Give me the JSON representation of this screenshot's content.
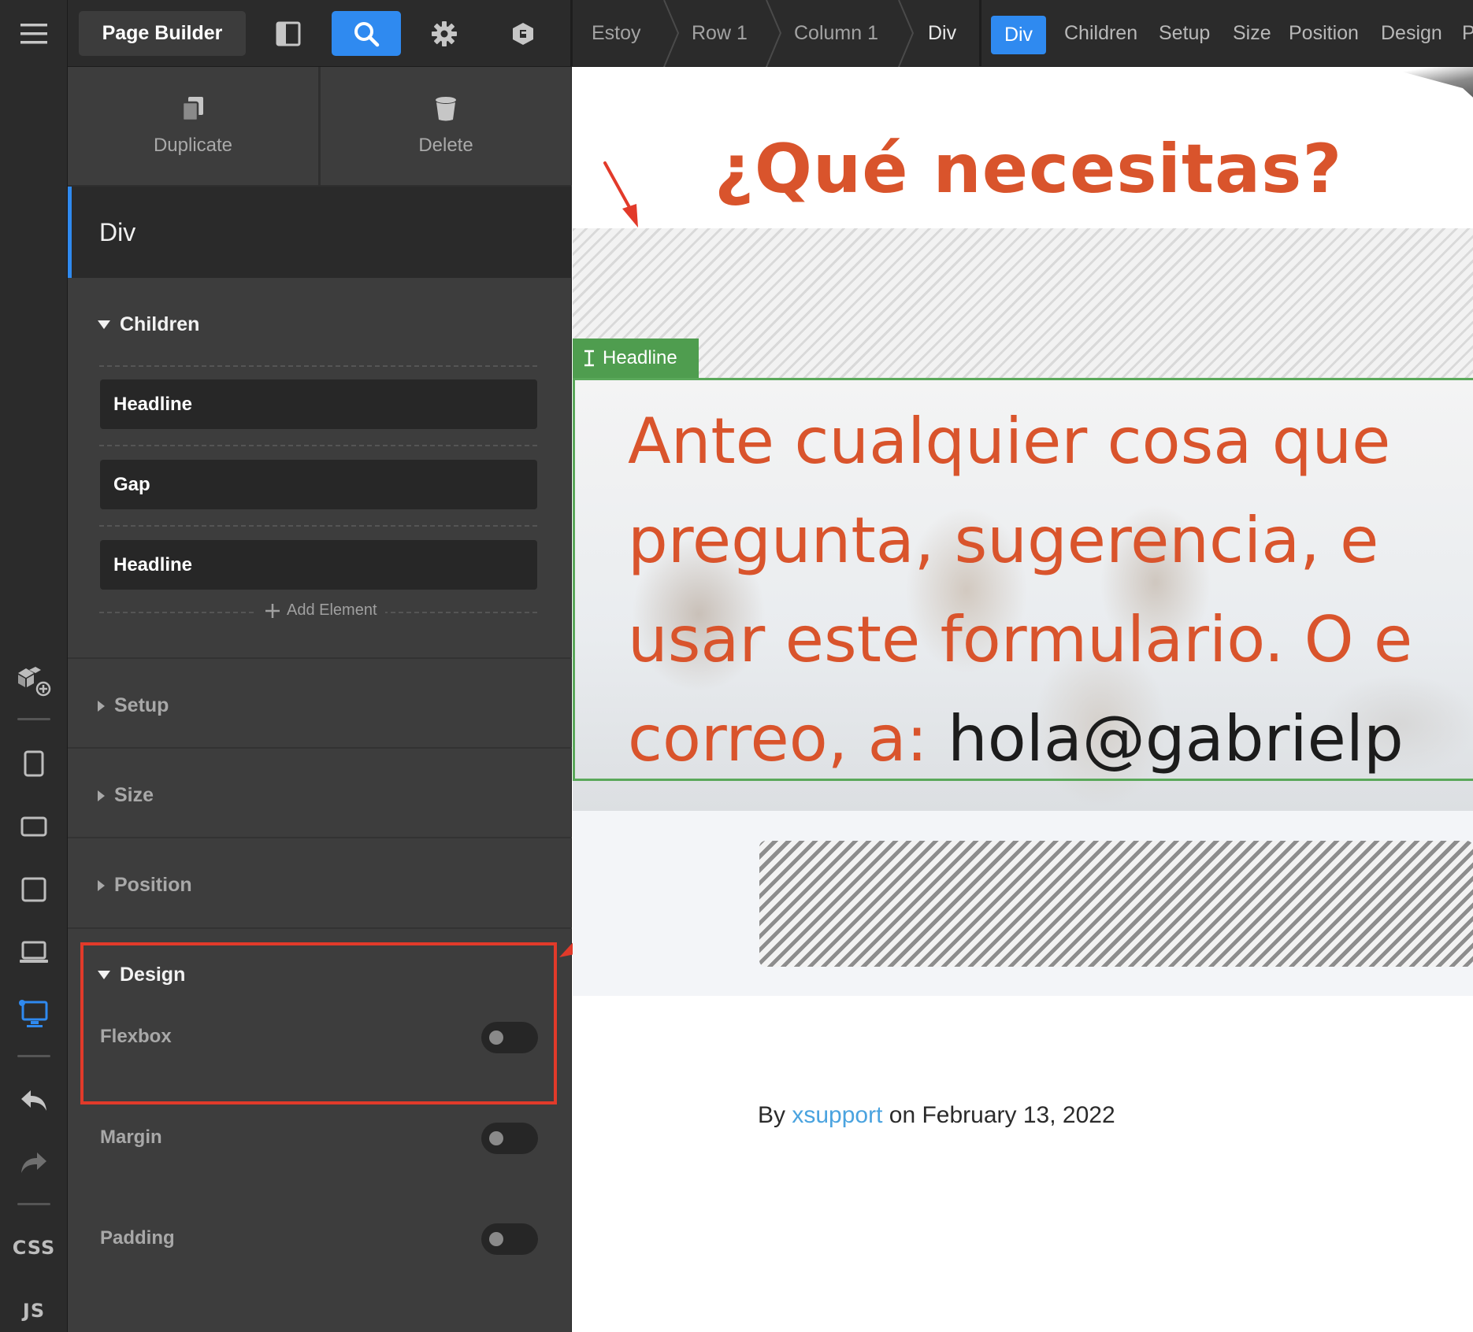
{
  "app": {
    "title": "Page Builder",
    "accent_color": "#2f8af0"
  },
  "rail": {
    "icons": [
      "menu-icon",
      "add-element-icon",
      "mobile-portrait-icon",
      "mobile-landscape-icon",
      "tablet-icon",
      "laptop-icon",
      "desktop-icon",
      "undo-icon",
      "redo-icon"
    ],
    "css_label": "CSS",
    "js_label": "JS"
  },
  "toolbar": {
    "icons": [
      "layout-panel-icon",
      "search-icon",
      "gear-icon",
      "cube-icon"
    ],
    "active_icon": "search-icon"
  },
  "breadcrumb": [
    "Estoy",
    "Row 1",
    "Column 1",
    "Div"
  ],
  "tabs": {
    "active": "Div",
    "items": [
      "Children",
      "Setup",
      "Size",
      "Position",
      "Design",
      "P"
    ]
  },
  "panel": {
    "actions": [
      {
        "label": "Duplicate",
        "icon": "duplicate-icon"
      },
      {
        "label": "Delete",
        "icon": "trash-icon"
      }
    ],
    "element_title": "Div",
    "children": {
      "heading": "Children",
      "items": [
        "Headline",
        "Gap",
        "Headline"
      ],
      "add_label": "Add Element"
    },
    "sections": [
      "Setup",
      "Size",
      "Position"
    ],
    "design": {
      "heading": "Design",
      "options": [
        {
          "label": "Flexbox",
          "on": false
        },
        {
          "label": "Margin",
          "on": false
        },
        {
          "label": "Padding",
          "on": false
        }
      ]
    }
  },
  "canvas": {
    "title": "¿Qué necesitas?",
    "headline_tag": "Headline",
    "headline_lines": [
      "Ante cualquier cosa que",
      "pregunta, sugerencia, e",
      "usar este formulario. O e",
      "correo, a: "
    ],
    "headline_email": "hola@gabrielp",
    "byline": {
      "prefix": "By ",
      "author": "xsupport",
      "suffix": " on February 13, 2022"
    },
    "text_color": "#d9542c",
    "link_color": "#4aa3df",
    "annotation_color": "#e23a2a"
  }
}
